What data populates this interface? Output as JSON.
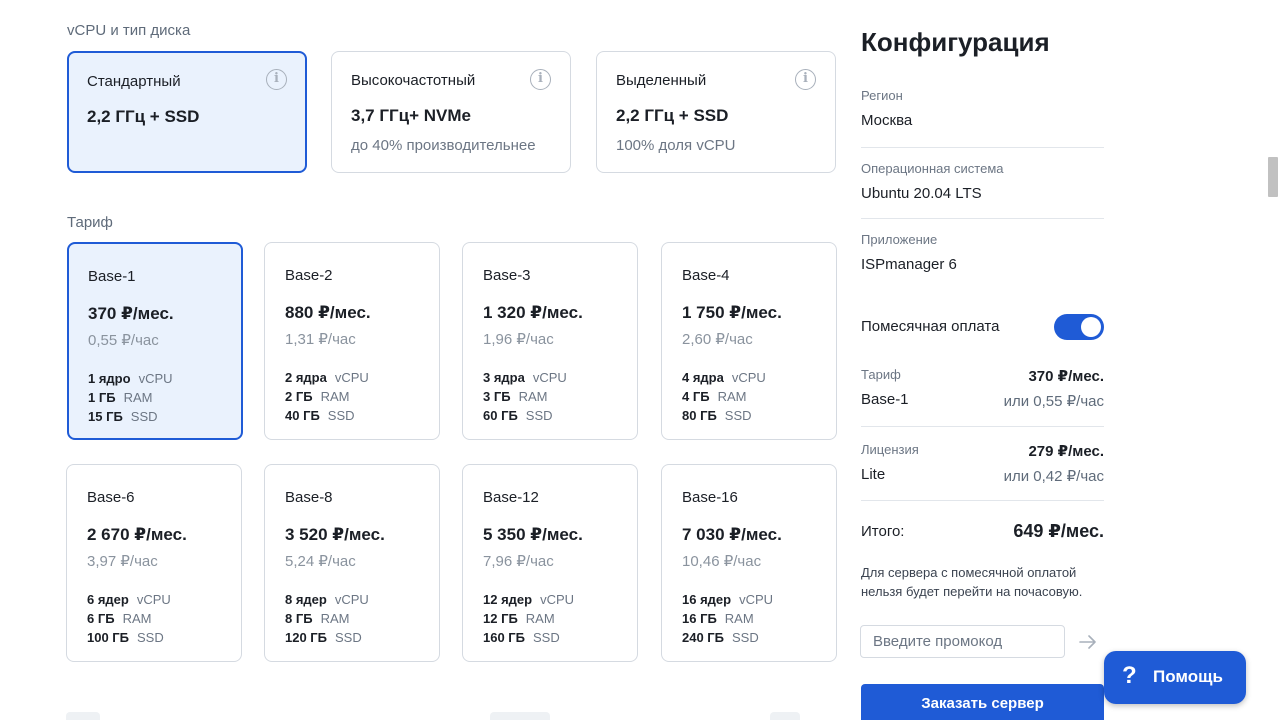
{
  "vcpu_section": {
    "label": "vCPU и тип диска",
    "options": [
      {
        "name": "Стандартный",
        "spec": "2,2 ГГц + SSD",
        "sub": "",
        "selected": true
      },
      {
        "name": "Высокочастотный",
        "spec": "3,7 ГГц+ NVMe",
        "sub": "до 40% производительнее",
        "selected": false
      },
      {
        "name": "Выделенный",
        "spec": "2,2 ГГц + SSD",
        "sub": "100% доля vCPU",
        "selected": false
      }
    ],
    "info_icon": "info-icon"
  },
  "tariff_section": {
    "label": "Тариф",
    "plans": [
      {
        "name": "Base-1",
        "price": "370 ₽/мес.",
        "hourly": "0,55 ₽/час",
        "cpu": "1 ядро",
        "ram": "1 ГБ",
        "ssd": "15 ГБ",
        "selected": true
      },
      {
        "name": "Base-2",
        "price": "880 ₽/мес.",
        "hourly": "1,31 ₽/час",
        "cpu": "2 ядра",
        "ram": "2 ГБ",
        "ssd": "40 ГБ",
        "selected": false
      },
      {
        "name": "Base-3",
        "price": "1 320 ₽/мес.",
        "hourly": "1,96 ₽/час",
        "cpu": "3 ядра",
        "ram": "3 ГБ",
        "ssd": "60 ГБ",
        "selected": false
      },
      {
        "name": "Base-4",
        "price": "1 750 ₽/мес.",
        "hourly": "2,60 ₽/час",
        "cpu": "4 ядра",
        "ram": "4 ГБ",
        "ssd": "80 ГБ",
        "selected": false
      },
      {
        "name": "Base-6",
        "price": "2 670 ₽/мес.",
        "hourly": "3,97 ₽/час",
        "cpu": "6 ядер",
        "ram": "6 ГБ",
        "ssd": "100 ГБ",
        "selected": false
      },
      {
        "name": "Base-8",
        "price": "3 520 ₽/мес.",
        "hourly": "5,24 ₽/час",
        "cpu": "8 ядер",
        "ram": "8 ГБ",
        "ssd": "120 ГБ",
        "selected": false
      },
      {
        "name": "Base-12",
        "price": "5 350 ₽/мес.",
        "hourly": "7,96 ₽/час",
        "cpu": "12 ядер",
        "ram": "12 ГБ",
        "ssd": "160 ГБ",
        "selected": false
      },
      {
        "name": "Base-16",
        "price": "7 030 ₽/мес.",
        "hourly": "10,46 ₽/час",
        "cpu": "16 ядер",
        "ram": "16 ГБ",
        "ssd": "240 ГБ",
        "selected": false
      }
    ],
    "units": {
      "cpu": "vCPU",
      "ram": "RAM",
      "ssd": "SSD"
    }
  },
  "config": {
    "title": "Конфигурация",
    "region_label": "Регион",
    "region_value": "Москва",
    "os_label": "Операционная система",
    "os_value": "Ubuntu 20.04 LTS",
    "app_label": "Приложение",
    "app_value": "ISPmanager 6",
    "monthly_label": "Помесячная оплата",
    "monthly_enabled": true,
    "tariff_label": "Тариф",
    "tariff_name": "Base-1",
    "tariff_price": "370 ₽/мес.",
    "tariff_hourly": "или 0,55 ₽/час",
    "license_label": "Лицензия",
    "license_name": "Lite",
    "license_price": "279 ₽/мес.",
    "license_hourly": "или 0,42 ₽/час",
    "total_label": "Итого:",
    "total_value": "649 ₽/мес.",
    "note": "Для сервера с помесячной оплатой нельзя будет перейти на почасовую.",
    "promo_placeholder": "Введите промокод",
    "order_button": "Заказать сервер"
  },
  "help": {
    "icon": "?",
    "label": "Помощь"
  },
  "colors": {
    "accent": "#1f5bd6",
    "selected_bg": "#eaf2fd",
    "border": "#d5dae1"
  }
}
